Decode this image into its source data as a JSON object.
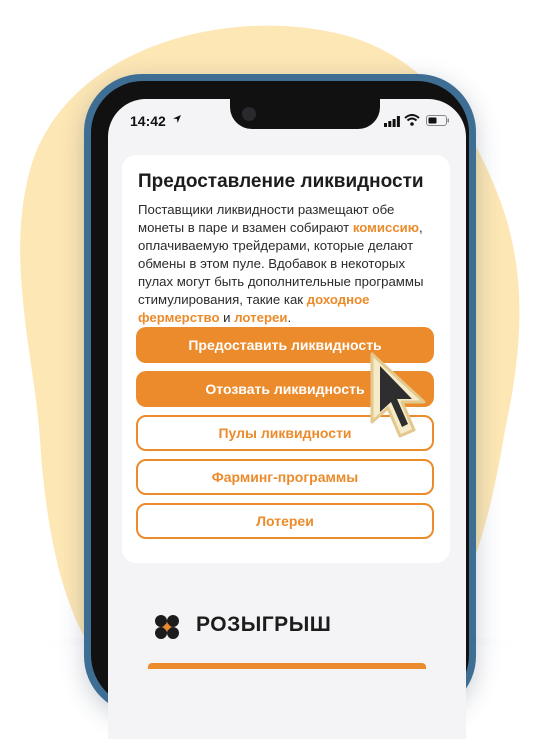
{
  "colors": {
    "accent": "#ec8b2b",
    "blob": "#fde7b5",
    "phone_frame": "#3f6e94",
    "screen_bg": "#f4f4f6"
  },
  "status_bar": {
    "time": "14:42",
    "icons": [
      "location-arrow-icon",
      "signal-icon",
      "wifi-icon",
      "battery-icon"
    ]
  },
  "liquidity_card": {
    "title": "Предоставление ликвидности",
    "body": {
      "part1": "Поставщики ликвидности размещают обе монеты в паре и взамен собирают ",
      "link_commission": "комиссию",
      "part2": ", оплачиваемую трейдерами, которые делают обмены в этом пуле. Вдобавок в некоторых пулах могут быть дополнительные программы стимулирования, такие как ",
      "link_farming": "доходное фермерство",
      "part3": " и ",
      "link_lotteries": "лотереи",
      "part4": "."
    },
    "buttons": {
      "provide_liquidity": "Предоставить ликвидность",
      "withdraw_liquidity": "Отозвать ликвидность",
      "liquidity_pools": "Пулы ликвидности",
      "farming_programs": "Фарминг-программы",
      "lotteries": "Лотереи"
    }
  },
  "raffle_section": {
    "icon": "clover-icon",
    "title": "РОЗЫГРЫШ"
  },
  "cursor": {
    "icon": "mouse-pointer-icon"
  }
}
